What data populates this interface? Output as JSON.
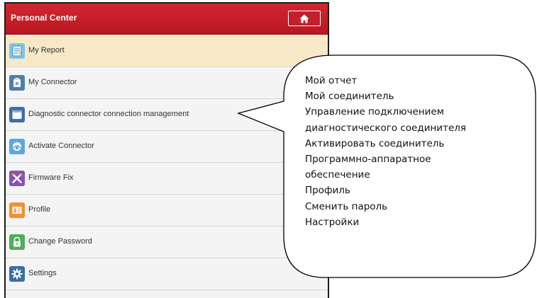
{
  "header": {
    "title": "Personal Center",
    "home_icon": "home-icon"
  },
  "menu": {
    "items": [
      {
        "label": "My Report",
        "icon": "report-icon",
        "active": true
      },
      {
        "label": "My Connector",
        "icon": "connector-icon",
        "active": false
      },
      {
        "label": "Diagnostic connector connection management",
        "icon": "connection-management-icon",
        "active": false
      },
      {
        "label": "Activate Connector",
        "icon": "activate-connector-icon",
        "active": false
      },
      {
        "label": "Firmware Fix",
        "icon": "firmware-fix-icon",
        "active": false
      },
      {
        "label": "Profile",
        "icon": "profile-icon",
        "active": false
      },
      {
        "label": "Change Password",
        "icon": "lock-icon",
        "active": false
      },
      {
        "label": "Settings",
        "icon": "gear-icon",
        "active": false
      }
    ]
  },
  "callout": {
    "lines": [
      "Мой отчет",
      "Мой соединитель",
      "Управление подключением",
      "диагностического соединителя",
      "Активировать соединитель",
      "Программно-аппаратное",
      "обеспечение",
      "Профиль",
      "Сменить пароль",
      "Настройки"
    ]
  },
  "colors": {
    "header_red": "#c41e28",
    "active_row": "#f7e9c7",
    "row_bg": "#f4f4f4"
  }
}
